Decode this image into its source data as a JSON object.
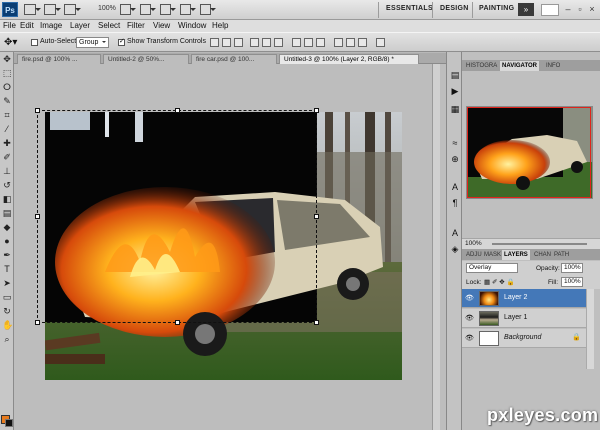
{
  "app": {
    "logo": "Ps",
    "zoom": "100%",
    "workspaces": [
      "ESSENTIALS",
      "DESIGN",
      "PAINTING"
    ],
    "more": "»"
  },
  "menu": [
    "File",
    "Edit",
    "Image",
    "Layer",
    "Select",
    "Filter",
    "View",
    "Window",
    "Help"
  ],
  "options": {
    "auto_select_label": "Auto-Select:",
    "auto_select_value": "Group",
    "show_transform_label": "Show Transform Controls"
  },
  "tabs": [
    "fire.psd @ 100% ...",
    "Untitled-2 @ 50%...",
    "fire car.psd @ 100...",
    "Untitled-3 @ 100% (Layer 2, RGB/8) *"
  ],
  "panels": {
    "top_tabs": [
      "HISTOGRA",
      "NAVIGATOR",
      "INFO"
    ],
    "nav_zoom": "100%",
    "layer_tabs": [
      "ADJU",
      "MASK",
      "LAYERS",
      "CHAN",
      "PATH"
    ],
    "blend_mode": "Overlay",
    "opacity_label": "Opacity:",
    "opacity_value": "100%",
    "lock_label": "Lock:",
    "fill_label": "Fill:",
    "fill_value": "100%",
    "layers": [
      {
        "name": "Layer 2",
        "selected": true
      },
      {
        "name": "Layer 1",
        "selected": false
      },
      {
        "name": "Background",
        "selected": false
      }
    ]
  },
  "watermark": "pxleyes.com",
  "colors": {
    "foreground": "#e77b1e",
    "background": "#111111",
    "selection": "#4478b8"
  }
}
